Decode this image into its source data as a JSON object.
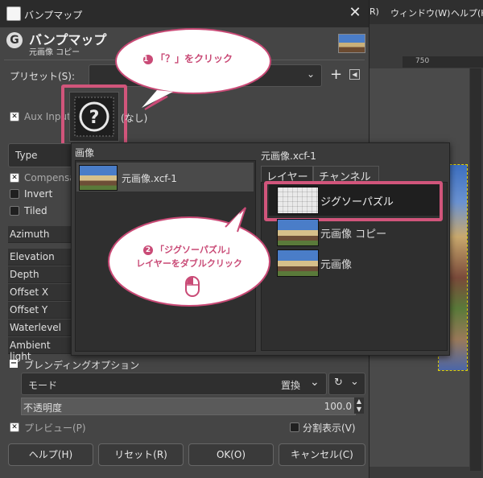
{
  "window": {
    "title": "バンプマップ"
  },
  "header": {
    "title": "バンプマップ",
    "subtitle": "元画像 コピー"
  },
  "background_app": {
    "menu": [
      "R)",
      "ウィンドウ(W)",
      "ヘルプ(H)"
    ],
    "ruler_value": "750"
  },
  "preset": {
    "label": "プリセット(S):",
    "value": ""
  },
  "aux_input": {
    "label": "Aux Input",
    "value": "(なし)"
  },
  "type_label": "Type",
  "options": {
    "compensate": "Compensate",
    "invert": "Invert",
    "tiled": "Tiled"
  },
  "params": [
    "Azimuth",
    "Elevation",
    "Depth",
    "Offset X",
    "Offset Y",
    "Waterlevel",
    "Ambient light"
  ],
  "blending": {
    "section": "ブレンディングオプション",
    "mode_label": "モード",
    "mode_value": "置換",
    "opacity_label": "不透明度",
    "opacity_value": "100.0"
  },
  "preview": {
    "label": "プレビュー(P)",
    "split_label": "分割表示(V)"
  },
  "buttons": {
    "help": "ヘルプ(H)",
    "reset": "リセット(R)",
    "ok": "OK(O)",
    "cancel": "キャンセル(C)"
  },
  "popup": {
    "images_header": "画像",
    "image_item": "元画像.xcf-1",
    "right_header": "元画像.xcf-1",
    "tabs": [
      "レイヤー",
      "チャンネル"
    ],
    "layers": [
      "ジグソーパズル",
      "元画像 コピー",
      "元画像"
    ]
  },
  "callouts": {
    "one_num": "1",
    "one_text": "「？」をクリック",
    "two_num": "2",
    "two_line1": "「ジグソーパズル」",
    "two_line2": "レイヤーをダブルクリック"
  },
  "colors": {
    "accent_pink": "#d1557b",
    "dialog_bg": "#454545"
  }
}
